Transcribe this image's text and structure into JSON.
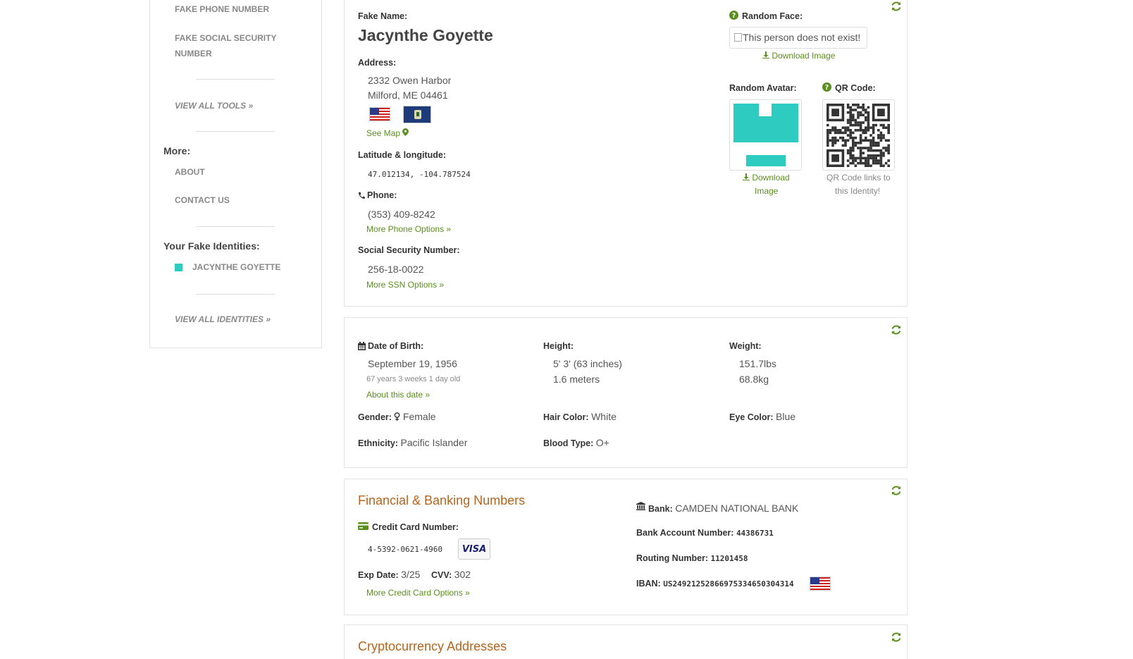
{
  "sidebar": {
    "tools": [
      "FAKE PHONE NUMBER",
      "FAKE SOCIAL SECURITY",
      "NUMBER"
    ],
    "view_all_tools": "VIEW ALL TOOLS »",
    "more_heading": "More:",
    "more_links": [
      "ABOUT",
      "CONTACT US"
    ],
    "identities_heading": "Your Fake Identities:",
    "identities": [
      "JACYNTHE GOYETTE"
    ],
    "view_all_identities": "VIEW ALL IDENTITIES »",
    "identity_color": "#2ecbc1"
  },
  "identity": {
    "name_label": "Fake Name:",
    "name": "Jacynthe Goyette",
    "address_label": "Address:",
    "address_line1": "2332 Owen Harbor",
    "address_line2": "Milford, ME 04461",
    "see_map": "See Map",
    "latlng_label": "Latitude & longitude:",
    "latlng": "47.012134, -104.787524",
    "phone_label": "Phone:",
    "phone": "(353) 409-8242",
    "more_phone": "More Phone Options »",
    "ssn_label": "Social Security Number:",
    "ssn": "256-18-0022",
    "more_ssn": "More SSN Options »",
    "face_label": "Random Face:",
    "face_alt": "This person does not exist!",
    "download_image": "Download Image",
    "avatar_label": "Random Avatar:",
    "avatar_download_1": "Download",
    "avatar_download_2": "Image",
    "qr_label": "QR Code:",
    "qr_note_1": "QR Code links to",
    "qr_note_2": "this Identity!"
  },
  "bio": {
    "dob_label": "Date of Birth:",
    "dob": "September 19, 1956",
    "age": "67 years 3 weeks 1 day old",
    "about_date": "About this date »",
    "height_label": "Height:",
    "height_imperial": "5' 3' (63 inches)",
    "height_metric": "1.6 meters",
    "weight_label": "Weight:",
    "weight_lbs": "151.7lbs",
    "weight_kg": "68.8kg",
    "gender_label": "Gender:",
    "gender": "Female",
    "hair_label": "Hair Color:",
    "hair": "White",
    "eye_label": "Eye Color:",
    "eye": "Blue",
    "ethnicity_label": "Ethnicity:",
    "ethnicity": "Pacific Islander",
    "blood_label": "Blood Type:",
    "blood": "O+"
  },
  "finance": {
    "title": "Financial & Banking Numbers",
    "cc_label": "Credit Card Number:",
    "cc_number": "4-5392-0621-4960",
    "card_brand": "VISA",
    "exp_label": "Exp Date:",
    "exp": "3/25",
    "cvv_label": "CVV:",
    "cvv": "302",
    "more_cc": "More Credit Card Options »",
    "bank_label": "Bank:",
    "bank": "CAMDEN NATIONAL BANK",
    "account_label": "Bank Account Number:",
    "account": "44386731",
    "routing_label": "Routing Number:",
    "routing": "11201458",
    "iban_label": "IBAN:",
    "iban": "US24921252866975334650304314"
  },
  "crypto": {
    "title": "Cryptocurrency Addresses"
  },
  "colors": {
    "link": "#5a8f1e",
    "section_title": "#b5651d",
    "avatar": "#2ecbc1"
  }
}
